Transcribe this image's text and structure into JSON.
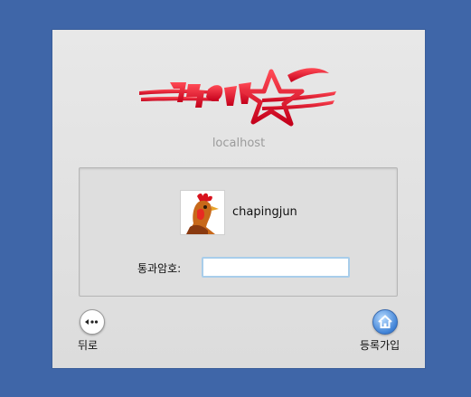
{
  "login": {
    "hostname": "localhost",
    "user": {
      "name": "chapingjun"
    },
    "password_label": "통과암호:",
    "password_value": "",
    "back_label": "뒤로",
    "register_label": "등록가입"
  },
  "icons": {
    "logo": "red-star-logo",
    "avatar": "rooster-avatar",
    "back": "back-arrow-icon",
    "register": "home-icon"
  },
  "colors": {
    "background": "#3f66a8",
    "window": "#e2e2e2",
    "logo_red": "#e0102a",
    "input_border": "#a8cdea",
    "home_blue": "#3f82d6"
  }
}
